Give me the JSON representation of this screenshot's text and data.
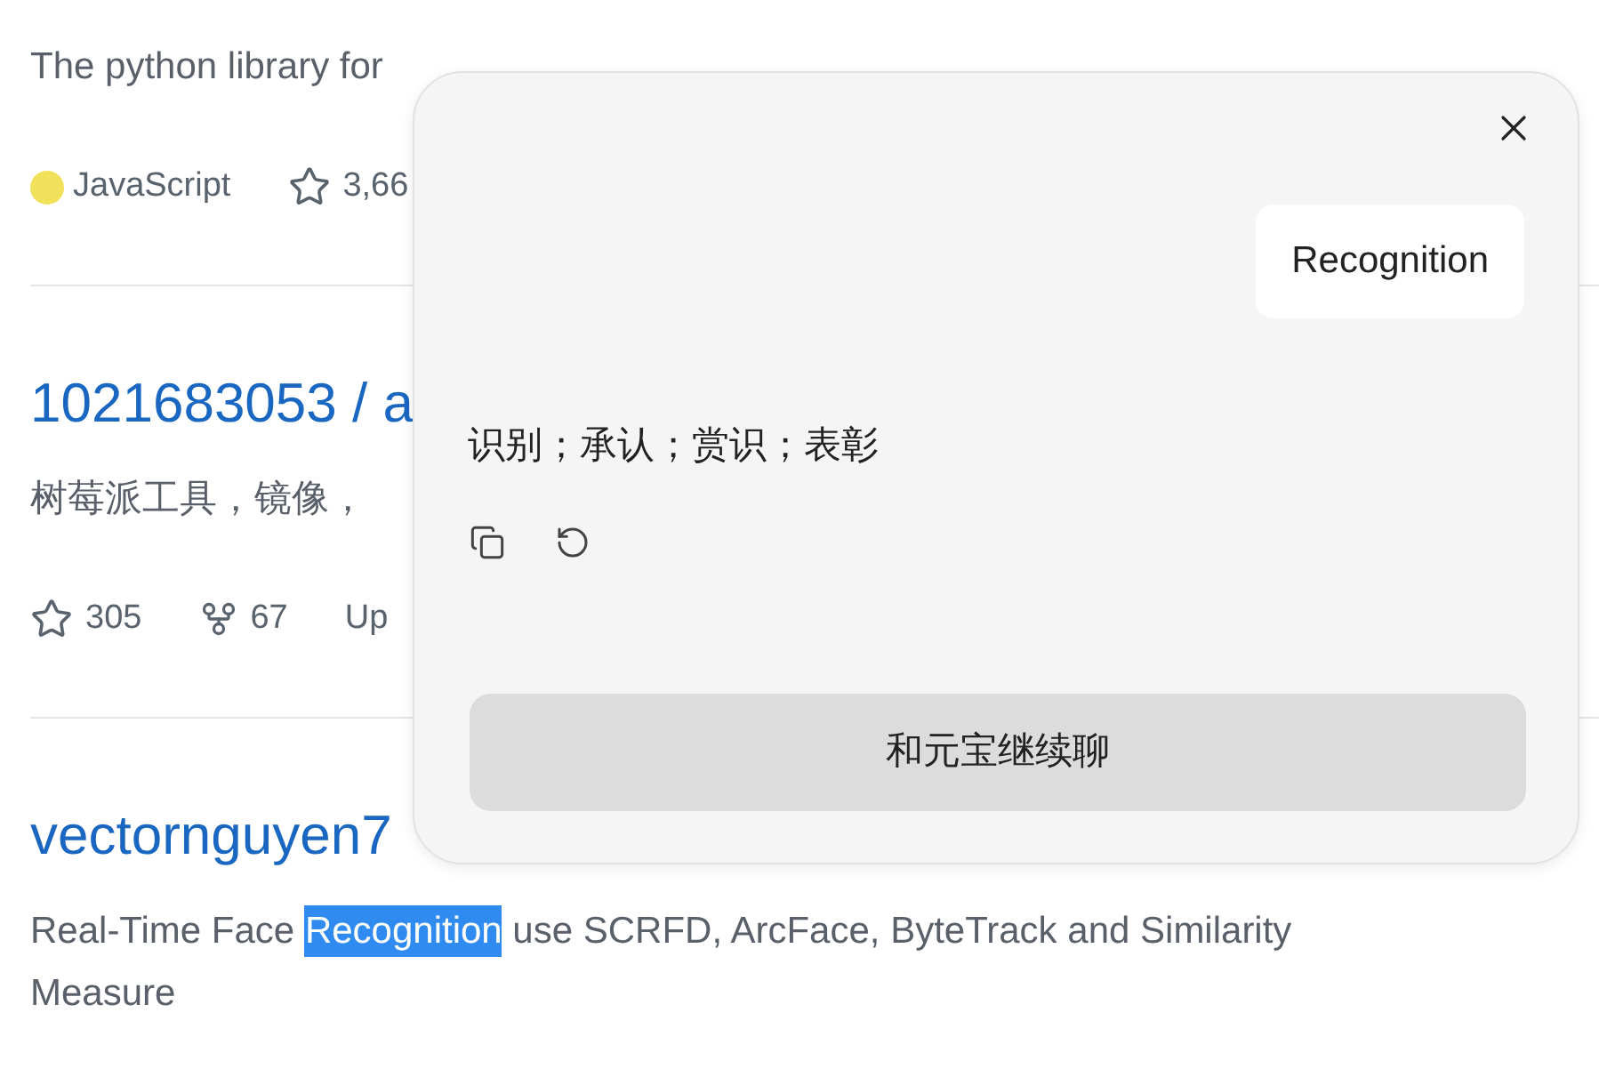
{
  "repos": [
    {
      "description": [
        {
          "text": "The python library for",
          "highlighted": false
        }
      ],
      "language": {
        "name": "JavaScript",
        "color": "#f1e05a"
      },
      "stats": [
        {
          "kind": "stars",
          "value": "3,66"
        }
      ]
    },
    {
      "title": "1021683053 / a",
      "description": [
        {
          "text": "树莓派工具，镜像，",
          "highlighted": false
        }
      ],
      "stats": [
        {
          "kind": "stars",
          "value": "305"
        },
        {
          "kind": "forks",
          "value": "67"
        },
        {
          "kind": "updated",
          "value": "Up"
        }
      ]
    },
    {
      "title": "vectornguyen7",
      "description": [
        {
          "text": "Real-Time Face ",
          "highlighted": false
        },
        {
          "text": "Recognition",
          "highlighted": true
        },
        {
          "text": " use SCRFD, ArcFace, ByteTrack and Similarity Measure",
          "highlighted": false
        }
      ]
    }
  ],
  "popup": {
    "query": "Recognition",
    "translation": "识别；承认；赏识；表彰",
    "actions": [
      {
        "kind": "copy"
      },
      {
        "kind": "refresh"
      }
    ],
    "button": "和元宝继续聊"
  }
}
